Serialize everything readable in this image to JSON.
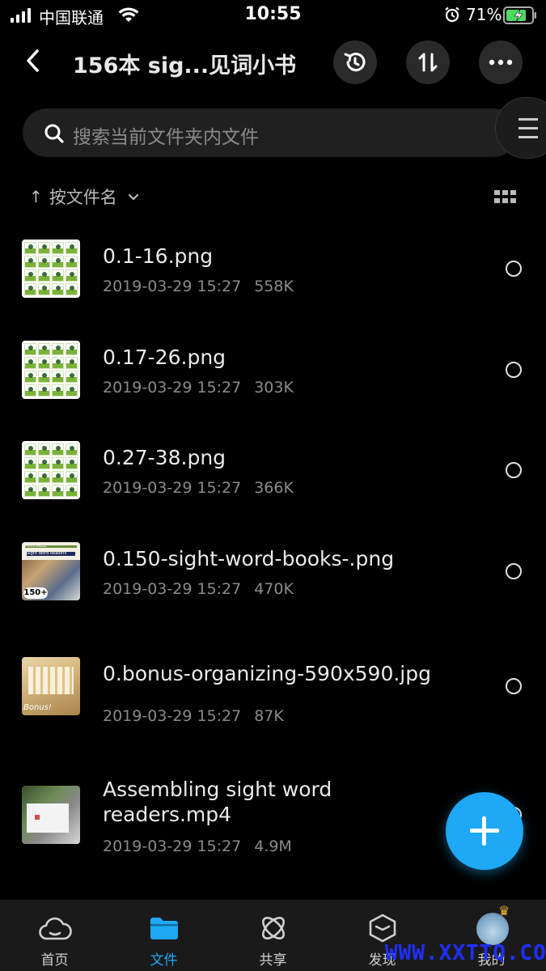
{
  "status_bar": {
    "carrier": "中国联通",
    "time": "10:55",
    "battery": "71%"
  },
  "header": {
    "title": "156本 sig...见词小书",
    "icons": [
      "back-icon",
      "history-icon",
      "sort-transfer-icon",
      "more-icon"
    ]
  },
  "search": {
    "placeholder": "搜索当前文件夹内文件",
    "menu_icon": "hamburger-icon"
  },
  "sort": {
    "arrow": "↑",
    "label": "按文件名"
  },
  "files": [
    {
      "name": "0.1-16.png",
      "date": "2019-03-29 15:27",
      "size": "558K"
    },
    {
      "name": "0.17-26.png",
      "date": "2019-03-29 15:27",
      "size": "303K"
    },
    {
      "name": "0.27-38.png",
      "date": "2019-03-29 15:27",
      "size": "366K"
    },
    {
      "name": "0.150-sight-word-books-.png",
      "date": "2019-03-29 15:27",
      "size": "470K",
      "thumb_text_1": "PRINTABLE",
      "thumb_text_2": "Sight Word Readers",
      "thumb_badge": "150+"
    },
    {
      "name": "0.bonus-organizing-590x590.jpg",
      "date": "2019-03-29 15:27",
      "size": "87K",
      "thumb_text": "Bonus!"
    },
    {
      "name_line1": "Assembling sight word",
      "name_line2": "readers.mp4",
      "date": "2019-03-29 15:27",
      "size": "4.9M"
    }
  ],
  "tabs": [
    {
      "label": "首页",
      "icon": "cloud-icon"
    },
    {
      "label": "文件",
      "icon": "folder-icon"
    },
    {
      "label": "共享",
      "icon": "atom-icon"
    },
    {
      "label": "发现",
      "icon": "cube-icon"
    },
    {
      "label": "我的",
      "icon": "avatar"
    }
  ],
  "watermark": "WWW.XXTTQ.COM",
  "colors": {
    "accent": "#1ea8f5",
    "background": "#000000",
    "secondary_text": "#8a8a8a"
  }
}
